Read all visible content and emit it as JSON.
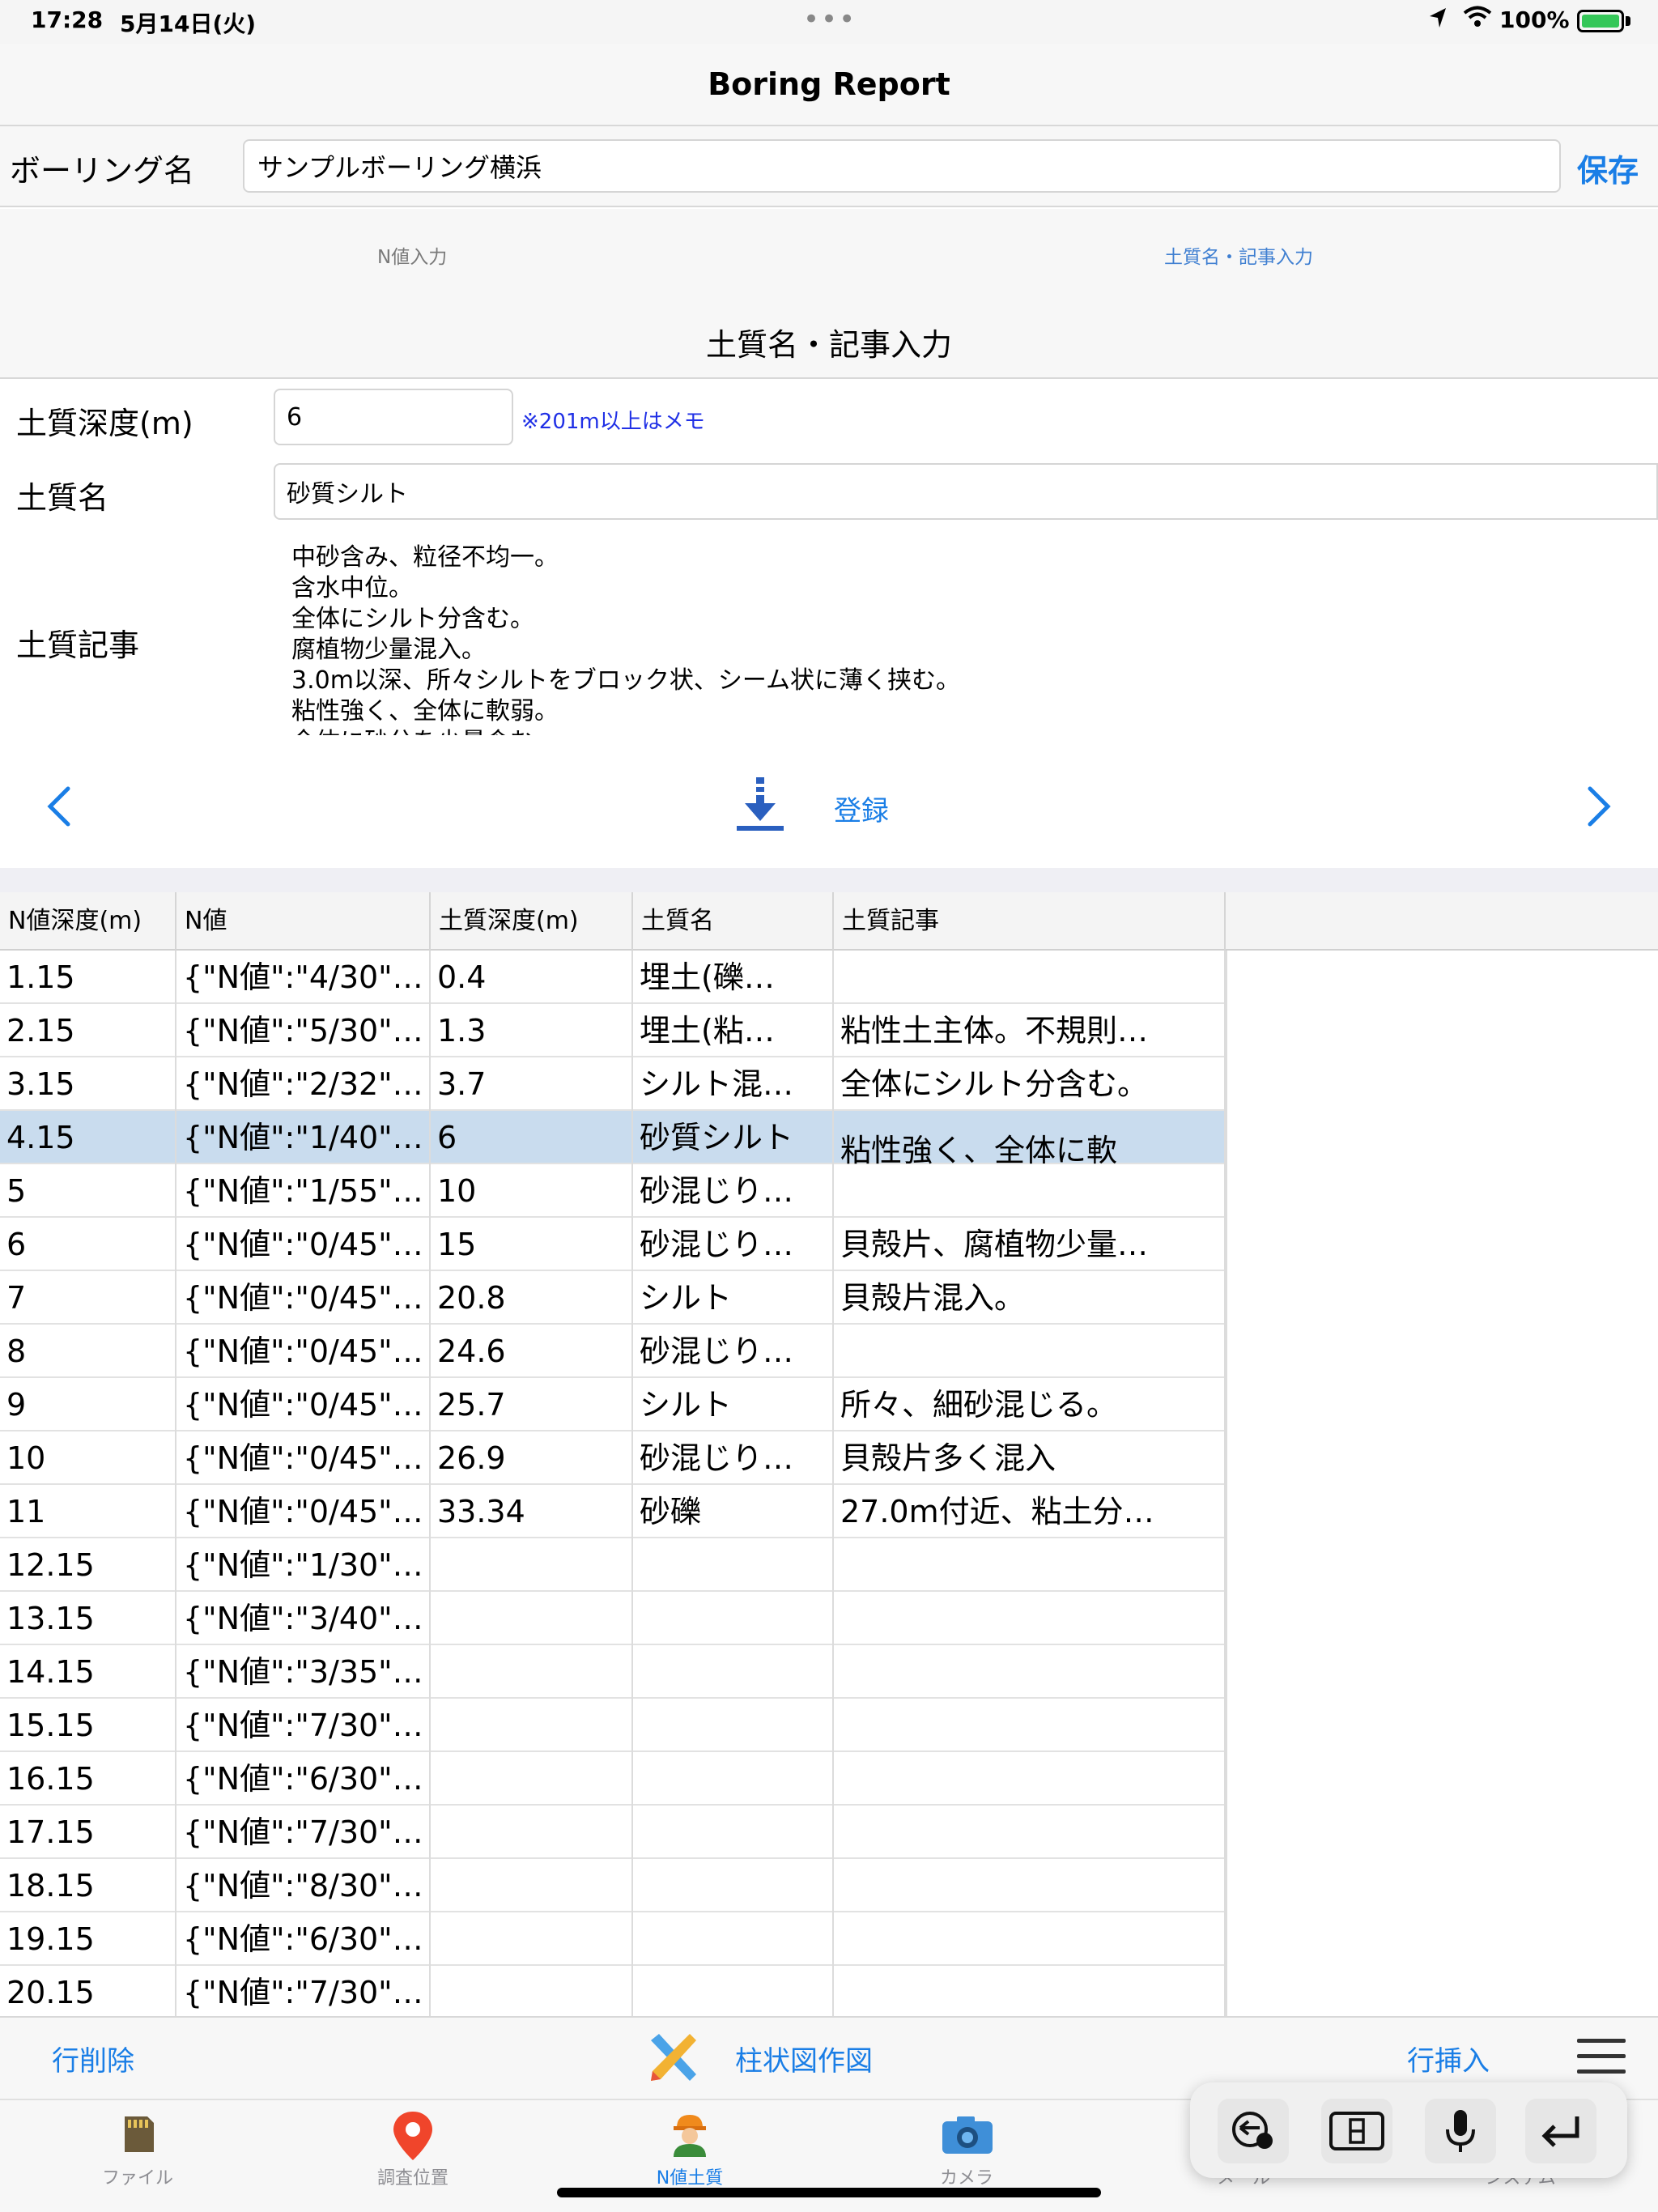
{
  "status": {
    "time": "17:28",
    "date": "5月14日(火)",
    "dots": "•••",
    "battery": "100%"
  },
  "nav": {
    "title": "Boring Report"
  },
  "boring": {
    "label": "ボーリング名",
    "value": "サンプルボーリング横浜",
    "save": "保存"
  },
  "tabs": {
    "n_input": "N値入力",
    "soil_input": "土質名・記事入力"
  },
  "section_title": "土質名・記事入力",
  "form": {
    "depth_label": "土質深度(m)",
    "depth_value": "6",
    "depth_note": "※201m以上はメモ",
    "soil_name_label": "土質名",
    "soil_name_value": "砂質シルト",
    "article_label": "土質記事",
    "article_value": "中砂含み、粒径不均一。\n含水中位。\n全体にシルト分含む。\n腐植物少量混入。\n3.0m以深、所々シルトをブロック状、シーム状に薄く挟む。\n粘性強く、全体に軟弱。\n全体に砂分を少量含む"
  },
  "register_label": "登録",
  "table": {
    "headers": [
      "N値深度(m)",
      "N値",
      "土質深度(m)",
      "土質名",
      "土質記事"
    ],
    "rows": [
      [
        "1.15",
        "{\"N値\":\"4/30\"…",
        "0.4",
        "埋土(礫…",
        ""
      ],
      [
        "2.15",
        "{\"N値\":\"5/30\"…",
        "1.3",
        "埋土(粘…",
        "粘性土主体。不規則…"
      ],
      [
        "3.15",
        "{\"N値\":\"2/32\"…",
        "3.7",
        "シルト混…",
        "全体にシルト分含む。"
      ],
      [
        "4.15",
        "{\"N値\":\"1/40\"…",
        "6",
        "砂質シルト",
        "粘性強く、全体に軟"
      ],
      [
        "5",
        "{\"N値\":\"1/55\"…",
        "10",
        "砂混じり…",
        ""
      ],
      [
        "6",
        "{\"N値\":\"0/45\"…",
        "15",
        "砂混じり…",
        "貝殻片、腐植物少量…"
      ],
      [
        "7",
        "{\"N値\":\"0/45\"…",
        "20.8",
        "シルト",
        "貝殻片混入。"
      ],
      [
        "8",
        "{\"N値\":\"0/45\"…",
        "24.6",
        "砂混じり…",
        ""
      ],
      [
        "9",
        "{\"N値\":\"0/45\"…",
        "25.7",
        "シルト",
        "所々、細砂混じる。"
      ],
      [
        "10",
        "{\"N値\":\"0/45\"…",
        "26.9",
        "砂混じり…",
        "貝殻片多く混入"
      ],
      [
        "11",
        "{\"N値\":\"0/45\"…",
        "33.34",
        "砂礫",
        "27.0m付近、粘土分…"
      ],
      [
        "12.15",
        "{\"N値\":\"1/30\"…",
        "",
        "",
        ""
      ],
      [
        "13.15",
        "{\"N値\":\"3/40\"…",
        "",
        "",
        ""
      ],
      [
        "14.15",
        "{\"N値\":\"3/35\"…",
        "",
        "",
        ""
      ],
      [
        "15.15",
        "{\"N値\":\"7/30\"…",
        "",
        "",
        ""
      ],
      [
        "16.15",
        "{\"N値\":\"6/30\"…",
        "",
        "",
        ""
      ],
      [
        "17.15",
        "{\"N値\":\"7/30\"…",
        "",
        "",
        ""
      ],
      [
        "18.15",
        "{\"N値\":\"8/30\"…",
        "",
        "",
        ""
      ],
      [
        "19.15",
        "{\"N値\":\"6/30\"…",
        "",
        "",
        ""
      ],
      [
        "20.15",
        "{\"N値\":\"7/30\"…",
        "",
        "",
        ""
      ]
    ],
    "selected_row": 3
  },
  "toolbar": {
    "delete_row": "行削除",
    "column_chart": "柱状図作図",
    "insert_row": "行挿入"
  },
  "tabbar": {
    "items": [
      {
        "label": "ファイル",
        "icon": "sd-card-icon"
      },
      {
        "label": "調査位置",
        "icon": "map-pin-icon"
      },
      {
        "label": "N値土質",
        "icon": "worker-icon"
      },
      {
        "label": "カメラ",
        "icon": "camera-icon"
      },
      {
        "label": "メール",
        "icon": "mail-icon"
      },
      {
        "label": "システム",
        "icon": "system-icon"
      }
    ]
  },
  "colors": {
    "accent": "#1a7ee6",
    "selected_row": "#c9dcee",
    "note_blue": "#2030e6"
  }
}
